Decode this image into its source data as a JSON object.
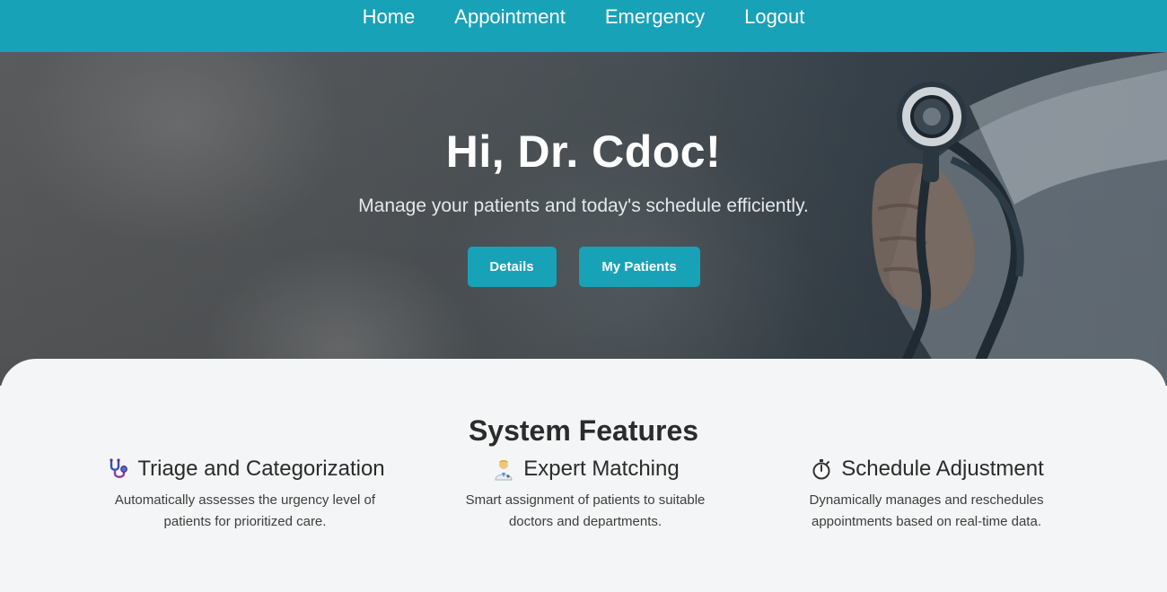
{
  "nav": {
    "links": [
      {
        "label": "Home"
      },
      {
        "label": "Appointment"
      },
      {
        "label": "Emergency"
      },
      {
        "label": "Logout"
      }
    ],
    "bg_color": "#18a2b8"
  },
  "hero": {
    "title": "Hi, Dr. Cdoc!",
    "subtitle": "Manage your patients and today's schedule efficiently.",
    "buttons": {
      "details": "Details",
      "my_patients": "My Patients"
    },
    "image": "doctor-holding-stethoscope"
  },
  "features": {
    "title": "System Features",
    "items": [
      {
        "icon": "stethoscope-icon",
        "title": "Triage and Categorization",
        "description": "Automatically assesses the urgency level of patients for prioritized care."
      },
      {
        "icon": "doctor-icon",
        "title": "Expert Matching",
        "description": "Smart assignment of patients to suitable doctors and departments."
      },
      {
        "icon": "stopwatch-icon",
        "title": "Schedule Adjustment",
        "description": "Dynamically manages and reschedules appointments based on real-time data."
      }
    ]
  }
}
